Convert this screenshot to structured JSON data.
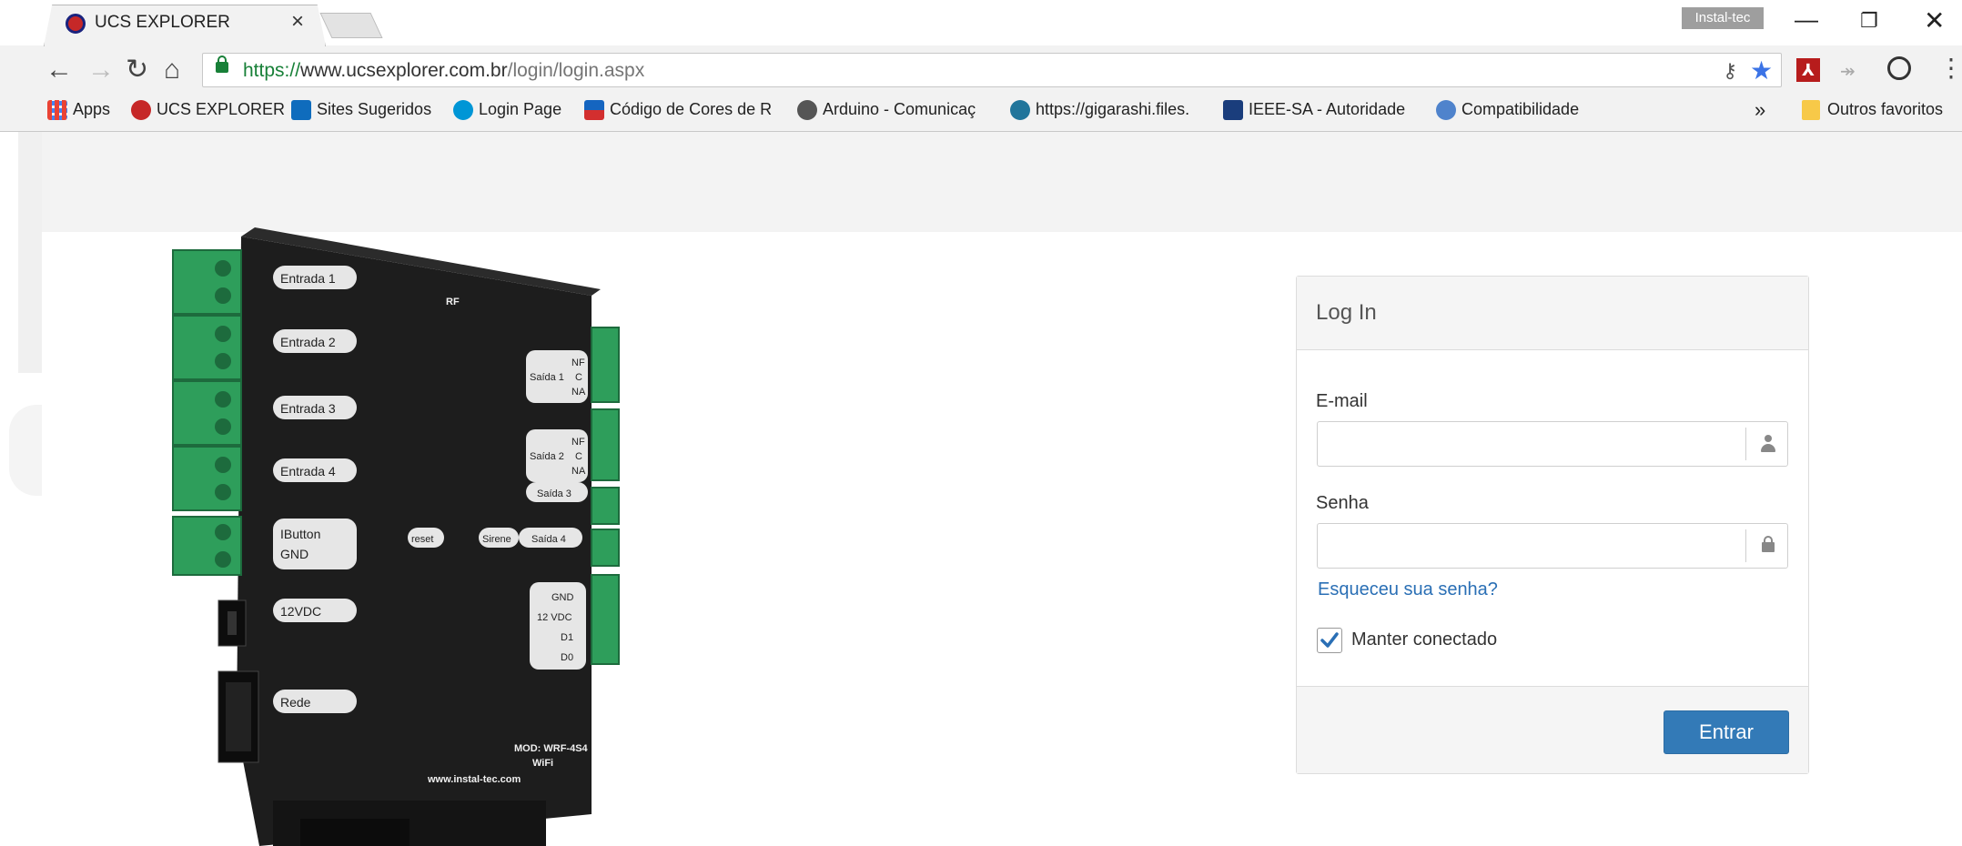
{
  "browser": {
    "tab_title": "UCS EXPLORER",
    "profile_badge": "Instal-tec",
    "url": {
      "scheme": "https://",
      "host": "www.ucsexplorer.com.br",
      "path": "/login/login.aspx"
    },
    "bookmarks": [
      {
        "label": "Apps",
        "icon": "apps-grid-icon",
        "color": "#ea4335"
      },
      {
        "label": "UCS EXPLORER",
        "icon": "ucs-explorer-favicon",
        "color": "#c62828"
      },
      {
        "label": "Sites Sugeridos",
        "icon": "bing-icon",
        "color": "#0f6cbd"
      },
      {
        "label": "Login Page",
        "icon": "hp-icon",
        "color": "#0096d6"
      },
      {
        "label": "Código de Cores de R",
        "icon": "areaseg-icon",
        "color": "#d32f2f"
      },
      {
        "label": "Arduino - Comunicaç",
        "icon": "camera-icon",
        "color": "#555555"
      },
      {
        "label": "https://gigarashi.files.",
        "icon": "wordpress-icon",
        "color": "#21759b"
      },
      {
        "label": "IEEE-SA - Autoridade",
        "icon": "ieee-icon",
        "color": "#1a3d7c"
      },
      {
        "label": "Compatibilidade",
        "icon": "puzzle-icon",
        "color": "#4f83cc"
      }
    ],
    "overflow_label": "»",
    "other_bookmarks": "Outros favoritos"
  },
  "login": {
    "title": "Log In",
    "email_label": "E-mail",
    "email_value": "",
    "password_label": "Senha",
    "password_value": "",
    "forgot_link": "Esqueceu sua senha?",
    "remember_label": "Manter conectado",
    "remember_checked": true,
    "submit_label": "Entrar"
  },
  "device": {
    "input_labels": [
      "Entrada 1",
      "Entrada 2",
      "Entrada 3",
      "Entrada 4"
    ],
    "ibutton_label": "IButton",
    "gnd_label": "GND",
    "power_label": "12VDC",
    "network_label": "Rede",
    "rf_label": "RF",
    "reset_label": "reset",
    "buzzer_label": "Sirene",
    "output_labels": [
      "Saída 1",
      "Saída 2",
      "Saída 3",
      "Saída 4"
    ],
    "relay_pins": [
      "NF",
      "C",
      "NA"
    ],
    "power_pins": [
      "GND",
      "12 VDC",
      "D1",
      "D0"
    ],
    "model_label": "MOD: WRF-4S4",
    "wifi_label": "WiFi",
    "site_label": "www.instal-tec.com"
  },
  "colors": {
    "accent": "#337ab7",
    "link": "#2a6fb5",
    "terminal_green": "#2e9e5b",
    "device_body": "#1d1d1d"
  }
}
